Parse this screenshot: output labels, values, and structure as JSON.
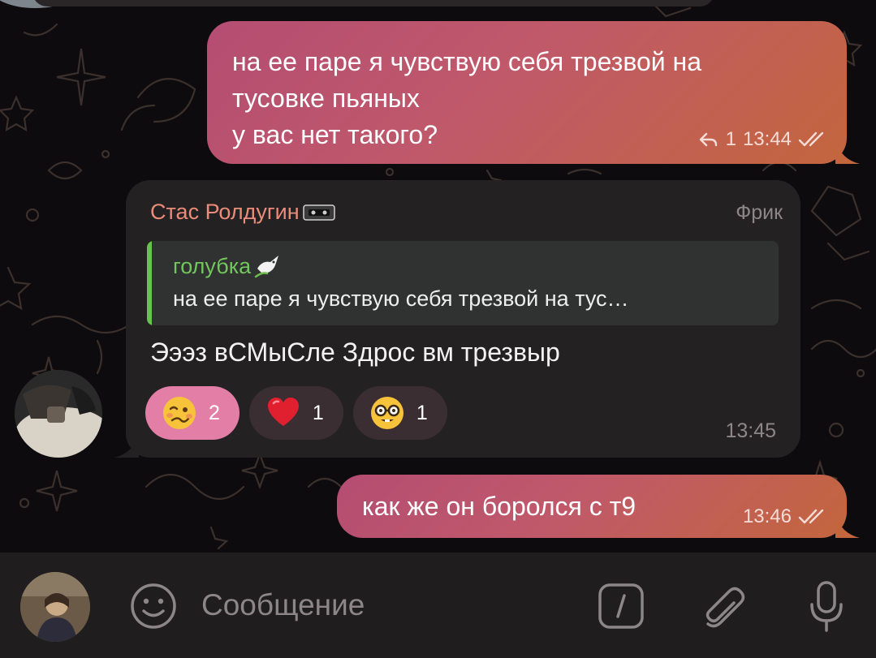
{
  "messages": {
    "m1": {
      "lines": [
        "на ее паре я чувствую себя трезвой на",
        "тусовке пьяных",
        "у вас нет такого?"
      ],
      "reply_count": "1",
      "time": "13:44"
    },
    "m2": {
      "sender": "Стас Ролдугин",
      "badge": "Фрик",
      "quote_name": "голубка",
      "quote_text": "на ее паре я чувствую себя трезвой на тус…",
      "text": "Эээз вСМыСле Здрос вм трезвыр",
      "reactions": [
        {
          "emoji": "woozy-face",
          "count": "2"
        },
        {
          "emoji": "red-heart",
          "count": "1"
        },
        {
          "emoji": "nerd-face",
          "count": "1"
        }
      ],
      "time": "13:45"
    },
    "m3": {
      "text": "как же он боролся с т9",
      "time": "13:46"
    }
  },
  "composer": {
    "placeholder": "Сообщение"
  },
  "colors": {
    "outgoing_gradient": [
      "#b44d72",
      "#c3663d"
    ],
    "incoming_bubble": "#242123",
    "sender_name": "#ea8c79",
    "quote_accent": "#67c24f",
    "active_reaction": "#e37ea6"
  }
}
